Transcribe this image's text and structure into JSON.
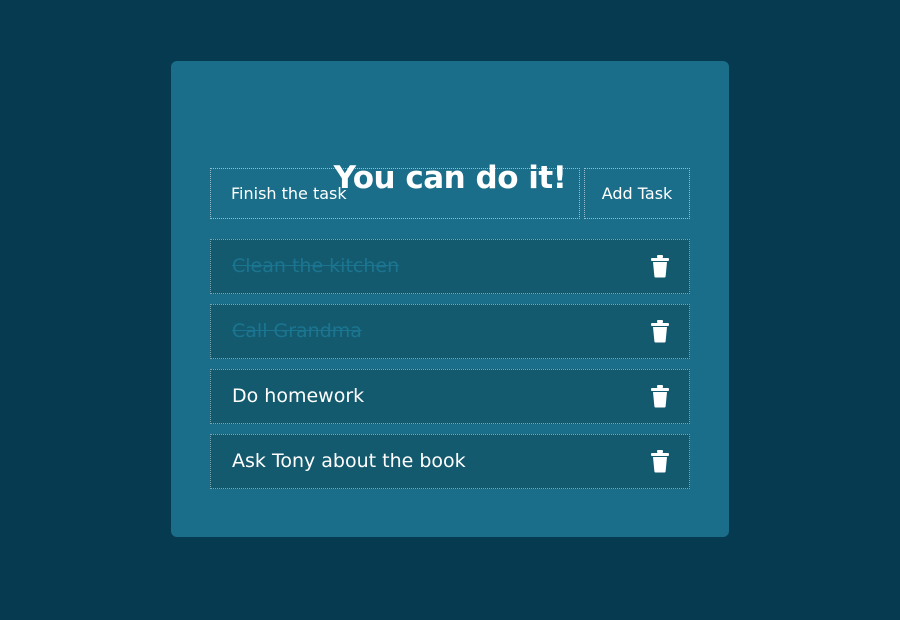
{
  "app": {
    "title": "You can do it!"
  },
  "new_task": {
    "value": "Finish the task",
    "add_label": "Add Task"
  },
  "tasks": [
    {
      "label": "Clean the kitchen",
      "completed": true
    },
    {
      "label": "Call Grandma",
      "completed": true
    },
    {
      "label": "Do homework",
      "completed": false
    },
    {
      "label": "Ask Tony about the book",
      "completed": false
    }
  ],
  "icons": {
    "delete": "trash-icon"
  },
  "colors": {
    "background": "#053a50",
    "card": "#1a6e8a",
    "task_row": "#145a6e",
    "text": "#ffffff",
    "completed_text": "#1b7590"
  }
}
